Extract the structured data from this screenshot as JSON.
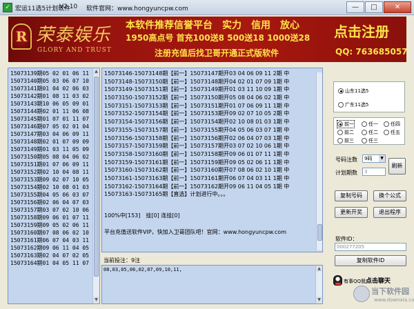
{
  "window": {
    "title": "宏运11选5计划软件",
    "version": "V2.10",
    "site": "软件官网：www.hongyuncpw.com",
    "buttons": {
      "minimize": "—",
      "maximize": "□",
      "close": "✕"
    }
  },
  "banner": {
    "logo_cn": "荣泰娱乐",
    "logo_en": "GLORY AND TRUST",
    "logo_seal": "R",
    "headline": "本软件推荐信誉平台　实力　信用　放心",
    "offer": "1950高点号 首充100送8 500送18 1000送28",
    "note": "注册充值后找卫哥开通正式版软件",
    "cta": "点击注册",
    "qq": "QQ: 763685057"
  },
  "history": [
    "15073139期05 02 01 06 11",
    "15073140期05 03 06 07 10",
    "15073141期01 04 02 06 03",
    "15073142期01 08 11 03 02",
    "15073143期10 06 05 09 01",
    "15073144期02 01 11 06 08",
    "15073145期01 07 01 11 07",
    "15073146期07 05 02 01 04",
    "15073147期03 04 06 09 11",
    "15073148期02 01 07 09 09",
    "15073149期01 03 11 05 09",
    "15073150期05 08 04 06 02",
    "15073151期01 07 06 09 11",
    "15073152期02 10 04 08 11",
    "15073153期09 02 07 10 05",
    "15073154期02 10 08 01 03",
    "15073155期04 05 06 03 07",
    "15073156期02 06 04 07 03",
    "15073157期03 07 02 10 06",
    "15073158期09 06 01 07 11",
    "15073159期09 05 02 06 11",
    "15073160期07 08 06 02 10",
    "15073161期06 07 04 03 11",
    "15073162期09 06 11 04 05",
    "15073163期02 04 07 02 05",
    "15073164期01 04 05 11 07"
  ],
  "plans": [
    "15073146-15073148期【前一】15073147期开03 04 06 09 11 2期 中",
    "15073148-15073150期【前一】15073148期开04 02 01 07 09 1期 中",
    "15073149-15073151期【前一】15073149期开01 03 11 10 09 1期 中",
    "15073150-15073152期【前一】15073150期开05 08 04 06 02 1期 中",
    "15073151-15073153期【前一】15073151期开01 07 06 09 11 1期 中",
    "15073152-15073154期【前一】15073153期开09 02 07 10 05 2期 中",
    "15073154-15073156期【前一】15073154期开02 10 08 01 03 1期 中",
    "15073155-15073157期【前一】15073155期开04 05 06 03 07 1期 中",
    "15073156-15073158期【前一】15073156期开02 06 04 07 03 1期 中",
    "15073157-15073159期【前一】15073157期开03 07 02 10 06 1期 中",
    "15073158-15073160期【前一】15073158期开09 06 01 07 11 1期 中",
    "15073159-15073161期【前一】15073159期开09 05 02 06 11 1期 中",
    "15073160-15073162期【前一】15073160期开07 08 06 02 10 1期 中",
    "15073161-15073163期【前一】15073161期开06 07 04 03 11 1期 中",
    "15073162-15073164期【前一】15073162期开09 06 11 04 05 1期 中",
    "15073163-15073165期【直选】计划进行中。。。"
  ],
  "plan_status": "100%中[153]　挂[0] 连挂[0]",
  "plan_promo": "平台充值送软件VIP，快加入卫哥团队吧！官网：www.hongyuncpw.com",
  "bet": {
    "label": "当前投注：9注",
    "numbers": "08,03,05,06,02,07,09,10,11,"
  },
  "lottery": {
    "options": [
      {
        "label": "山东11选5",
        "selected": true
      },
      {
        "label": "广东11选5",
        "selected": false
      }
    ]
  },
  "mode": {
    "options": [
      {
        "label": "前一",
        "selected": true
      },
      {
        "label": "任一",
        "selected": false
      },
      {
        "label": "任四",
        "selected": false
      },
      {
        "label": "前二",
        "selected": false
      },
      {
        "label": "任二",
        "selected": false
      },
      {
        "label": "任五",
        "selected": false
      },
      {
        "label": "前三",
        "selected": false
      },
      {
        "label": "任三",
        "selected": false
      }
    ]
  },
  "controls": {
    "count_label": "号码注数",
    "count_value": "9码",
    "period_label": "计划期数",
    "period_value": "3",
    "refresh": "刷新",
    "copy_numbers": "复制号码",
    "change_formula": "换个公式",
    "new_plan": "更新开奖",
    "exit": "退出程序",
    "software_id_label": "软件ID：",
    "software_id_value": "000277205",
    "copy_id": "复制软件ID"
  },
  "chat": {
    "prefix": "有事QQ我",
    "action": "点击聊天"
  },
  "watermark": {
    "cn": "当下软件园",
    "en": "www.downxia.com"
  }
}
